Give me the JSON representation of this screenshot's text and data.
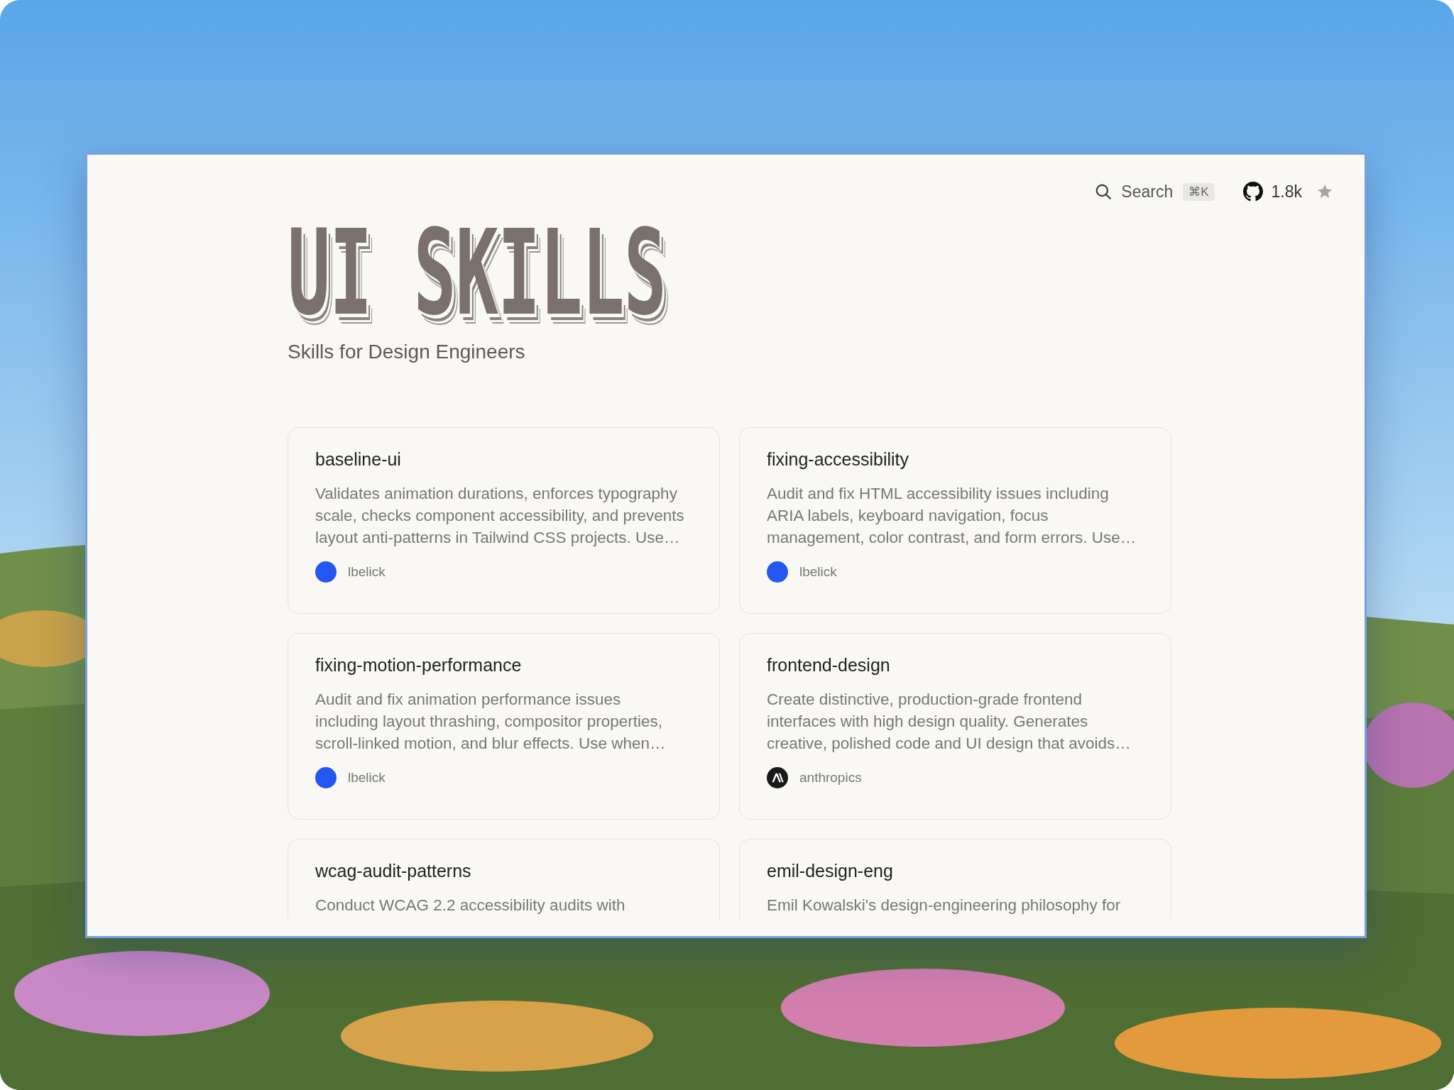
{
  "header": {
    "search": {
      "label": "Search",
      "shortcut": "⌘K"
    },
    "github": {
      "stars": "1.8k"
    }
  },
  "hero": {
    "title": "UI SKILLS",
    "subtitle": "Skills for Design Engineers"
  },
  "skills": [
    {
      "name": "baseline-ui",
      "description": "Validates animation durations, enforces typography scale, checks component accessibility, and prevents layout anti-patterns in Tailwind CSS projects. Use…",
      "author": "lbelick",
      "kind": "dot"
    },
    {
      "name": "fixing-accessibility",
      "description": "Audit and fix HTML accessibility issues including ARIA labels, keyboard navigation, focus management, color contrast, and form errors. Use…",
      "author": "lbelick",
      "kind": "dot"
    },
    {
      "name": "fixing-motion-performance",
      "description": "Audit and fix animation performance issues including layout thrashing, compositor properties, scroll-linked motion, and blur effects. Use when…",
      "author": "lbelick",
      "kind": "dot"
    },
    {
      "name": "frontend-design",
      "description": "Create distinctive, production-grade frontend interfaces with high design quality. Generates creative, polished code and UI design that avoids…",
      "author": "anthropics",
      "kind": "logo"
    },
    {
      "name": "wcag-audit-patterns",
      "description": "Conduct WCAG 2.2 accessibility audits with"
    },
    {
      "name": "emil-design-eng",
      "description": "Emil Kowalski's design-engineering philosophy for"
    }
  ]
}
